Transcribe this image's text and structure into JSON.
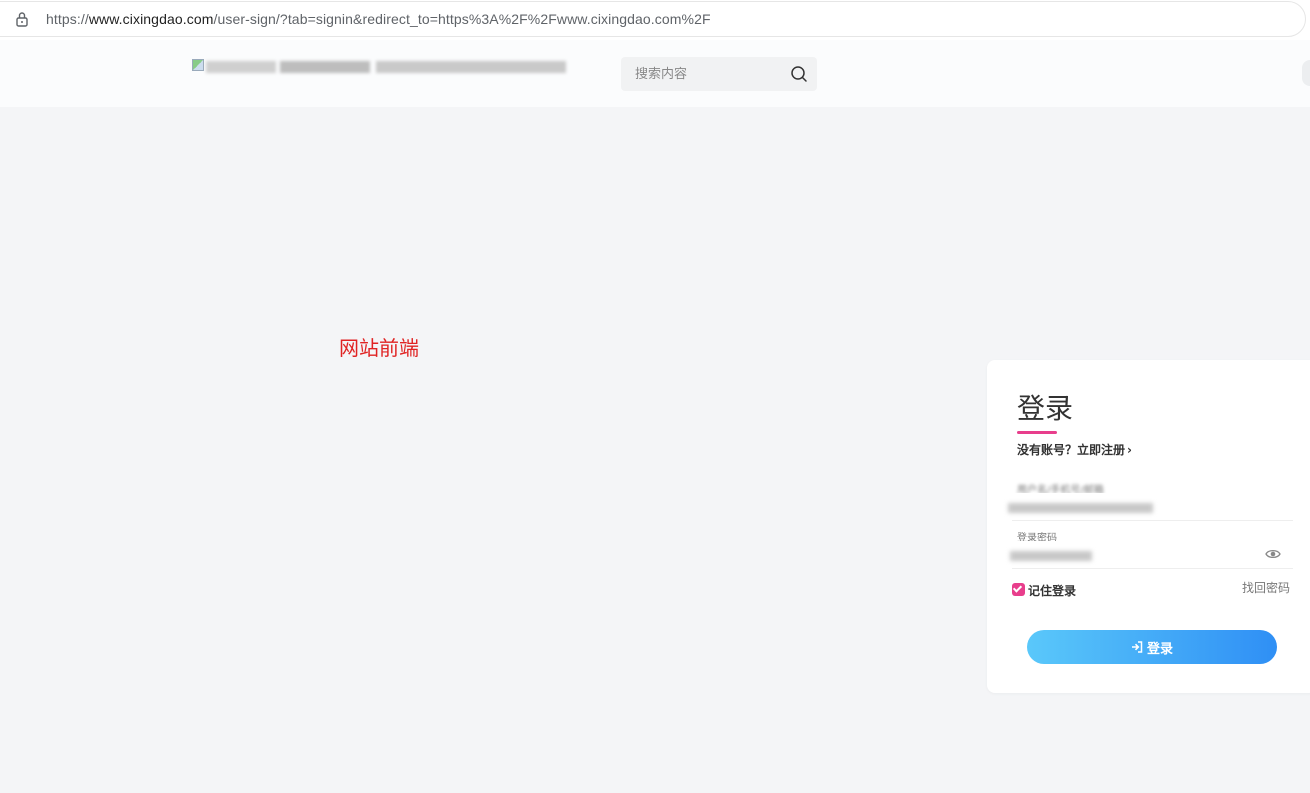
{
  "browser": {
    "url_prefix": "https://",
    "url_host": "www.cixingdao.com",
    "url_path": "/user-sign/?tab=signin&redirect_to=https%3A%2F%2Fwww.cixingdao.com%2F"
  },
  "header": {
    "search_placeholder": "搜索内容"
  },
  "main": {
    "frontend_label": "网站前端"
  },
  "login": {
    "title": "登录",
    "register_prompt": "没有账号？立即注册",
    "username_label": "用户名/手机号/邮箱",
    "password_label": "登录密码",
    "remember_label": "记住登录",
    "remember_checked": true,
    "forgot_label": "找回密码",
    "submit_label": "登录"
  },
  "colors": {
    "accent_pink": "#e83e8c",
    "button_gradient_start": "#5ac8fa",
    "button_gradient_end": "#2f8ff5",
    "annotation_red": "#e02424"
  },
  "icons": [
    "lock-icon",
    "search-icon",
    "eye-icon",
    "chevron-right-icon",
    "login-icon",
    "checkbox-checked"
  ]
}
